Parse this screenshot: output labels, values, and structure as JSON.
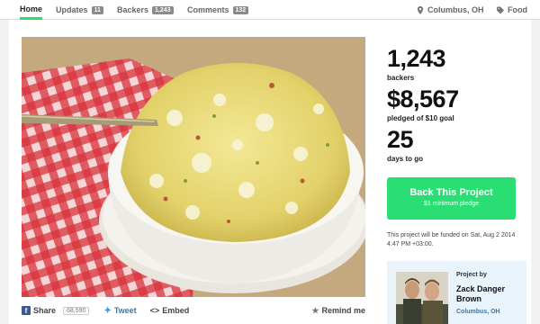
{
  "nav": {
    "home": "Home",
    "updates": "Updates",
    "updates_count": "11",
    "backers": "Backers",
    "backers_count": "1,243",
    "comments": "Comments",
    "comments_count": "132",
    "location": "Columbus, OH",
    "category": "Food"
  },
  "stats": {
    "backers_num": "1,243",
    "backers_label": "backers",
    "pledged_num": "$8,567",
    "pledged_label": "pledged of $10 goal",
    "days_num": "25",
    "days_label": "days to go"
  },
  "cta": {
    "title": "Back This Project",
    "subtitle": "$1 minimum pledge"
  },
  "funded_note": "This project will be funded on Sat, Aug 2 2014 4:47 PM +03:00.",
  "creator": {
    "project_by": "Project by",
    "name": "Zack Danger Brown",
    "location": "Columbus, OH"
  },
  "share": {
    "share_label": "Share",
    "share_count": "68,590",
    "tweet_label": "Tweet",
    "embed_label": "Embed",
    "remind_label": "Remind me"
  },
  "colors": {
    "accent": "#2bde73",
    "link": "#2b7bb9",
    "creator_bg": "#e9f3fb"
  },
  "icons": [
    "map-pin-icon",
    "tag-icon",
    "facebook-icon",
    "twitter-icon",
    "embed-icon",
    "star-icon"
  ]
}
